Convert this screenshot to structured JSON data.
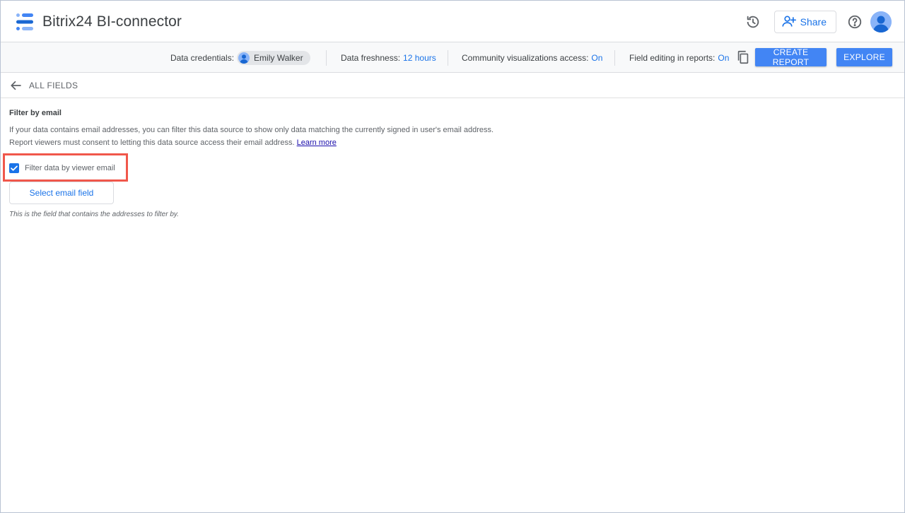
{
  "header": {
    "title": "Bitrix24 BI-connector",
    "share_label": "Share"
  },
  "icons": {
    "logo": "datastudio-logo-icon",
    "history": "history-icon",
    "share": "person-add-icon",
    "help": "help-icon",
    "avatar": "account-avatar-icon",
    "copy": "copy-icon",
    "back": "arrow-back-icon"
  },
  "toolbar": {
    "credentials_label": "Data credentials:",
    "credentials_user": "Emily Walker",
    "freshness_label": "Data freshness:",
    "freshness_value": "12 hours",
    "community_label": "Community visualizations access:",
    "community_value": "On",
    "field_editing_label": "Field editing in reports:",
    "field_editing_value": "On",
    "create_report_label": "CREATE REPORT",
    "explore_label": "EXPLORE"
  },
  "nav": {
    "back_label": "ALL FIELDS"
  },
  "filter": {
    "title": "Filter by email",
    "description_line1": "If your data contains email addresses, you can filter this data source to show only data matching the currently signed in user's email address.",
    "description_line2": "Report viewers must consent to letting this data source access their email address.",
    "learn_more": "Learn more",
    "checkbox_label": "Filter data by viewer email",
    "checkbox_checked": true,
    "select_button_label": "Select email field",
    "hint": "This is the field that contains the addresses to filter by."
  },
  "colors": {
    "accent": "#1a73e8",
    "button_primary": "#4285f4",
    "highlight": "#f0574b"
  }
}
